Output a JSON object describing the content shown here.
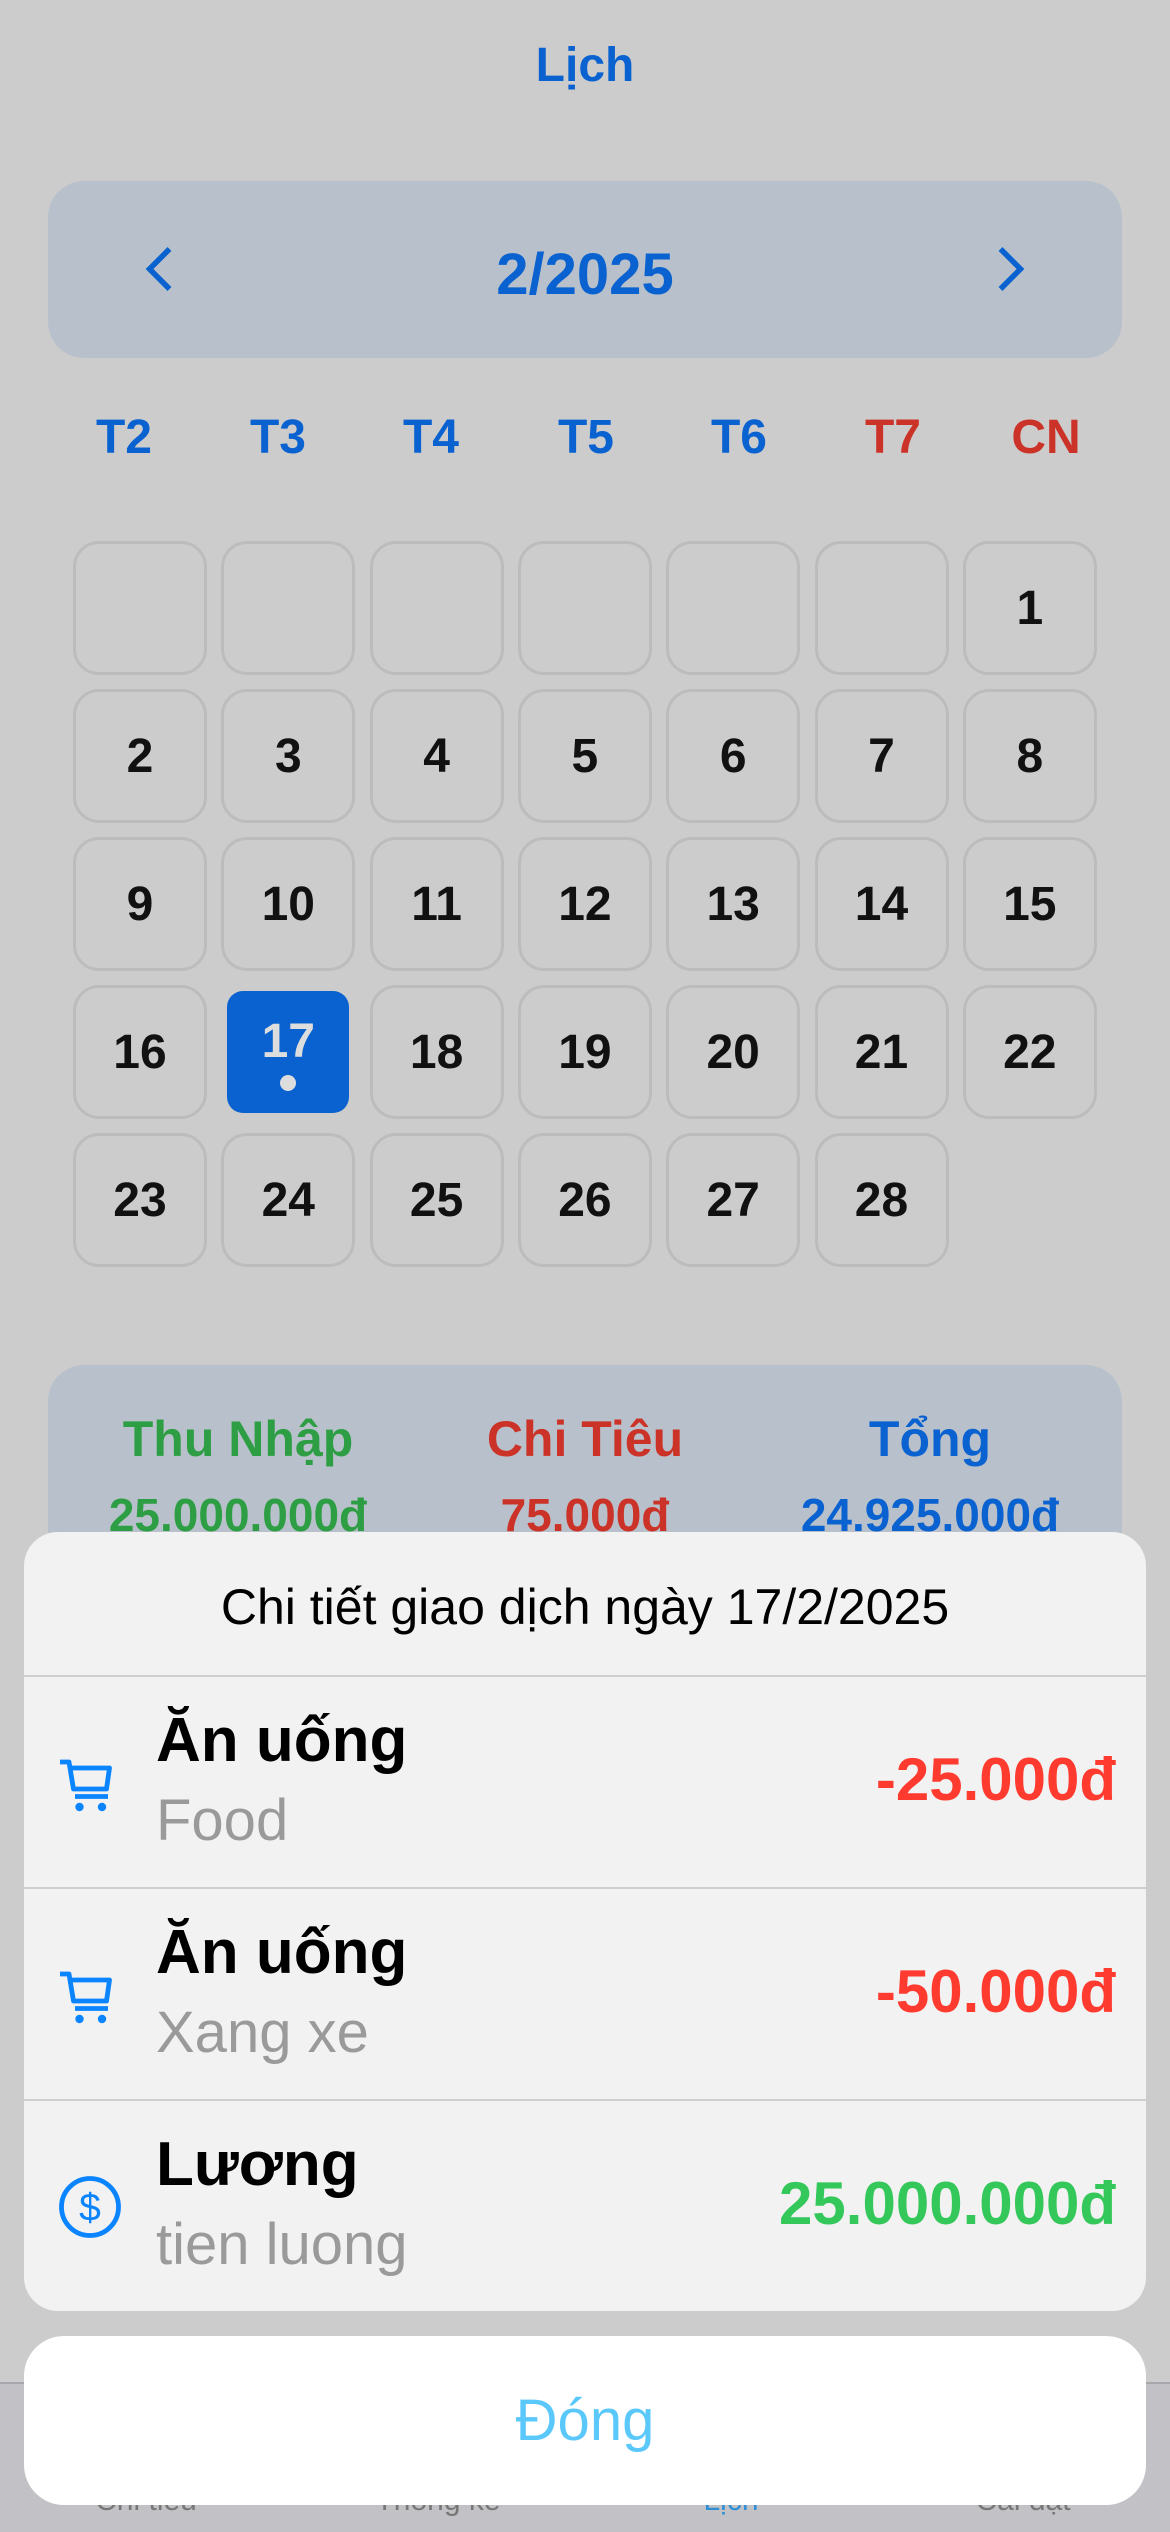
{
  "header": {
    "title": "Lịch"
  },
  "month_nav": {
    "label": "2/2025",
    "prev_icon": "chevron-left-icon",
    "next_icon": "chevron-right-icon"
  },
  "weekdays": [
    "T2",
    "T3",
    "T4",
    "T5",
    "T6",
    "T7",
    "CN"
  ],
  "calendar": {
    "leading_blanks": 6,
    "days": [
      "1",
      "2",
      "3",
      "4",
      "5",
      "6",
      "7",
      "8",
      "9",
      "10",
      "11",
      "12",
      "13",
      "14",
      "15",
      "16",
      "17",
      "18",
      "19",
      "20",
      "21",
      "22",
      "23",
      "24",
      "25",
      "26",
      "27",
      "28"
    ],
    "selected_day": "17"
  },
  "summary": {
    "income_label": "Thu Nhập",
    "income_value": "25.000.000đ",
    "expense_label": "Chi Tiêu",
    "expense_value": "75.000đ",
    "total_label": "Tổng",
    "total_value": "24.925.000đ"
  },
  "sheet": {
    "title": "Chi tiết giao dịch ngày 17/2/2025",
    "rows": [
      {
        "icon": "cart-icon",
        "name": "Ăn uống",
        "note": "Food",
        "amount": "-25.000đ",
        "type": "expense"
      },
      {
        "icon": "cart-icon",
        "name": "Ăn uống",
        "note": "Xang xe",
        "amount": "-50.000đ",
        "type": "expense"
      },
      {
        "icon": "dollar-circle-icon",
        "name": "Lương",
        "note": "tien luong",
        "amount": "25.000.000đ",
        "type": "income"
      }
    ],
    "close_label": "Đóng"
  },
  "tabs": [
    "Chi tiêu",
    "Thống kê",
    "Lịch",
    "Cài đặt"
  ],
  "colors": {
    "accent": "#0a62d0",
    "income": "#34c759",
    "expense": "#ff3b30",
    "sum_income": "#2e9e44",
    "sum_expense": "#cc3328"
  }
}
